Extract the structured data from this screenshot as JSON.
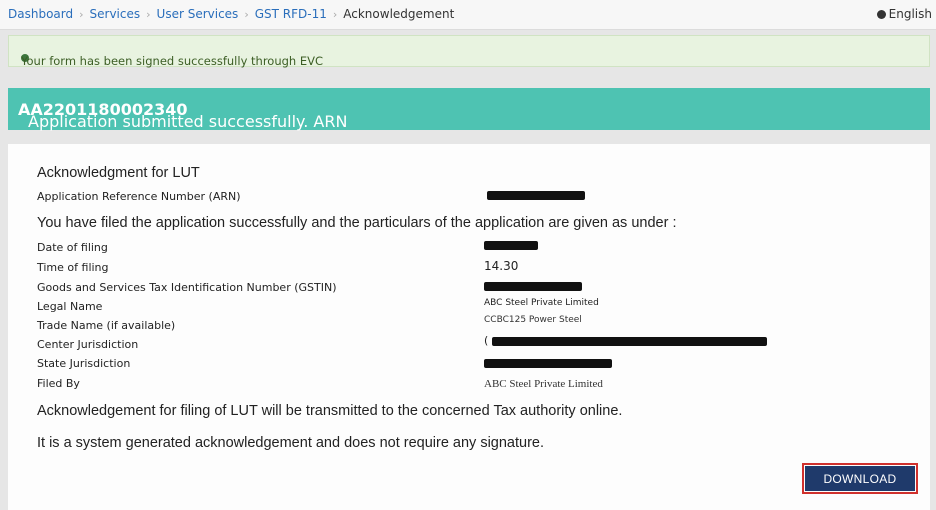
{
  "breadcrumb": {
    "items": [
      "Dashboard",
      "Services",
      "User Services",
      "GST RFD-11"
    ],
    "current": "Acknowledgement",
    "language": "English"
  },
  "alert": {
    "text": "Your form has been signed successfully through EVC"
  },
  "banner": {
    "text": "Application submitted successfully. ARN",
    "arn": "AA2201180002340"
  },
  "ack": {
    "title": "Acknowledgment for LUT",
    "arn_label": "Application Reference Number (ARN)",
    "intro": "You have filed the application successfully and the particulars of the application are given as under :",
    "rows": [
      {
        "label": "Date of filing",
        "value": ""
      },
      {
        "label": "Time of filing",
        "value": "14.30"
      },
      {
        "label": "Goods and Services Tax Identification Number (GSTIN)",
        "value": ""
      },
      {
        "label": "Legal Name",
        "value": "ABC Steel Private Limited"
      },
      {
        "label": "Trade Name (if available)",
        "value": "CCBC125 Power Steel"
      },
      {
        "label": "Center Jurisdiction",
        "value": "("
      },
      {
        "label": "State Jurisdiction",
        "value": ""
      },
      {
        "label": "Filed By",
        "value": "ABC Steel Private Limited"
      }
    ],
    "note1": "Acknowledgement for filing of LUT will be transmitted to the concerned Tax authority online.",
    "note2": "It is a system generated acknowledgement and does not require any signature.",
    "download_label": "DOWNLOAD"
  }
}
